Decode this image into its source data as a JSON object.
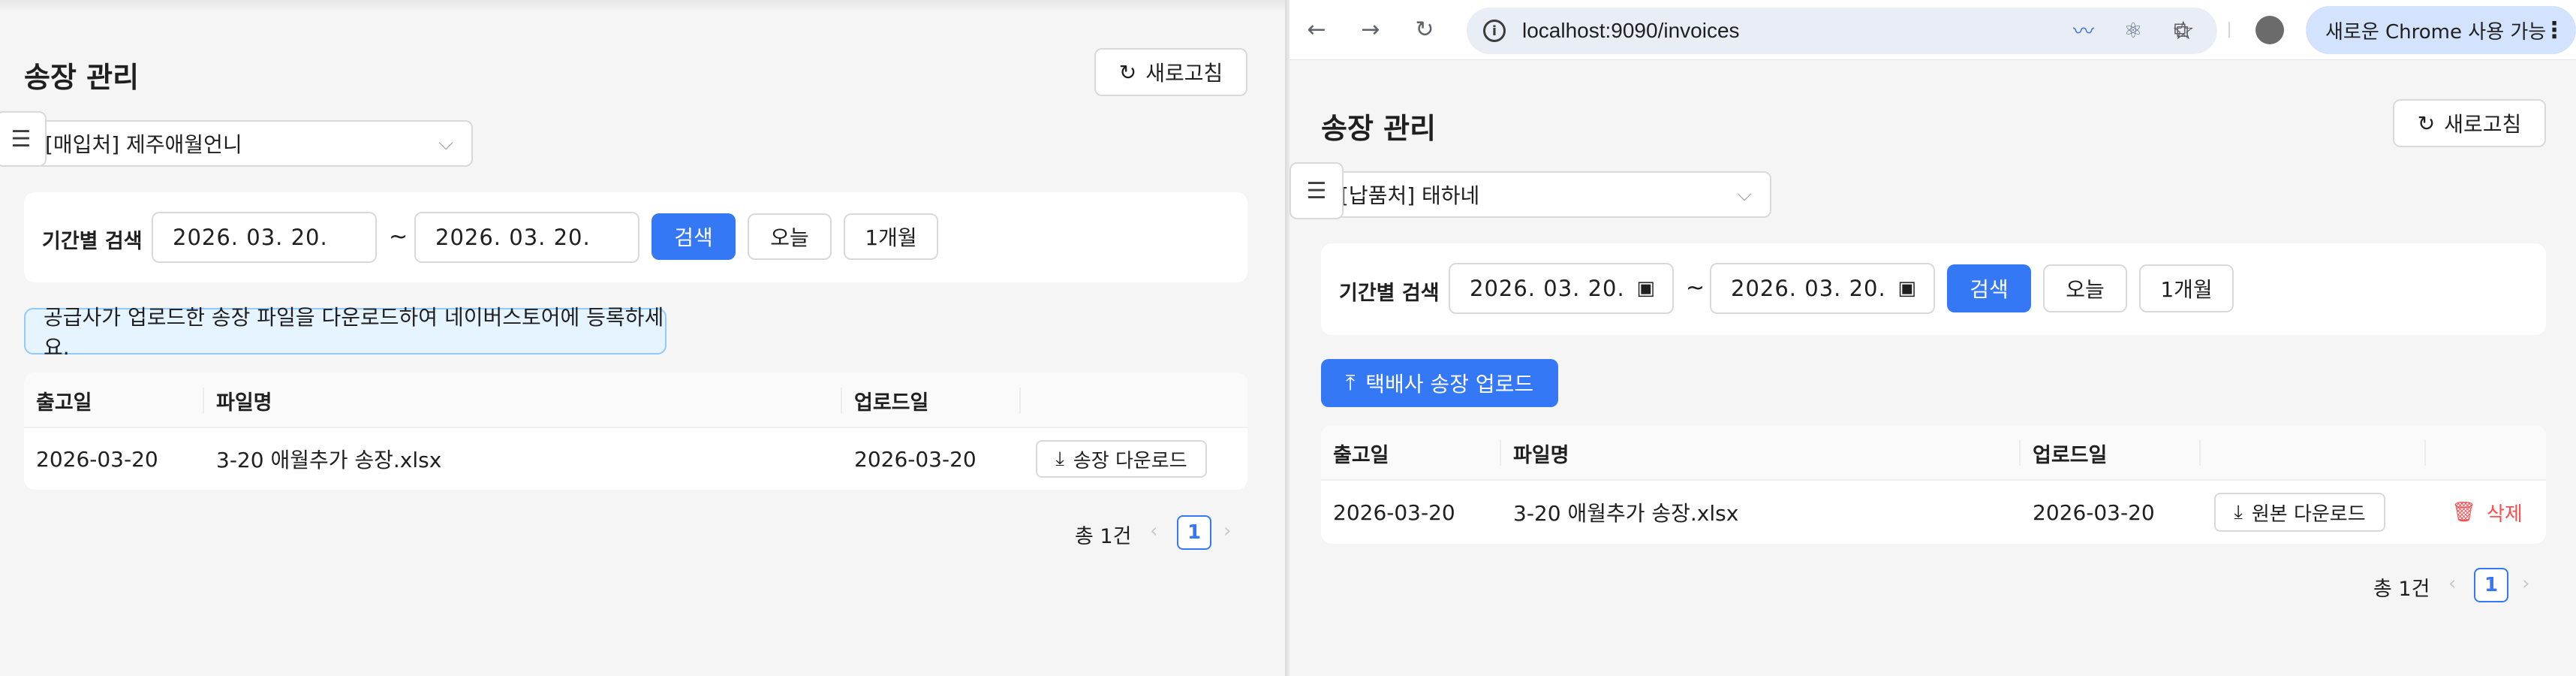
{
  "left": {
    "title": "송장 관리",
    "refresh_label": "새로고침",
    "vendor_select": "[매입처] 제주애월언니",
    "search": {
      "label": "기간별 검색",
      "start_date": "2026. 03. 20.",
      "separator": "~",
      "end_date": "2026. 03. 20.",
      "search_label": "검색",
      "today_label": "오늘",
      "month_label": "1개월"
    },
    "notice": "공급사가 업로드한 송장 파일을 다운로드하여 네이버스토어에 등록하세요.",
    "table": {
      "headers": [
        "출고일",
        "파일명",
        "업로드일",
        ""
      ],
      "rows": [
        {
          "ship_date": "2026-03-20",
          "file_name": "3-20 애월추가 송장.xlsx",
          "upload_date": "2026-03-20",
          "action": "송장 다운로드"
        }
      ]
    },
    "pagination": {
      "total": "총 1건",
      "current": "1",
      "prev": "‹",
      "next": "›"
    }
  },
  "right": {
    "browser": {
      "url": "localhost:9090/invoices",
      "update_label": "새로운 Chrome 사용 가능"
    },
    "title": "송장 관리",
    "refresh_label": "새로고침",
    "vendor_select": "[납품처] 태하네",
    "search": {
      "label": "기간별 검색",
      "start_date": "2026. 03. 20.",
      "separator": "~",
      "end_date": "2026. 03. 20.",
      "search_label": "검색",
      "today_label": "오늘",
      "month_label": "1개월"
    },
    "upload_label": "택배사 송장 업로드",
    "table": {
      "headers": [
        "출고일",
        "파일명",
        "업로드일",
        "",
        ""
      ],
      "rows": [
        {
          "ship_date": "2026-03-20",
          "file_name": "3-20 애월추가 송장.xlsx",
          "upload_date": "2026-03-20",
          "action": "원본 다운로드",
          "delete": "삭제"
        }
      ]
    },
    "pagination": {
      "total": "총 1건",
      "current": "1",
      "prev": "‹",
      "next": "›"
    }
  },
  "colors": {
    "primary": "#3478f6",
    "danger": "#ff4d4f",
    "notice_bg": "#e6f4ff",
    "notice_border": "#91caff",
    "page_bg": "#f5f5f5"
  }
}
